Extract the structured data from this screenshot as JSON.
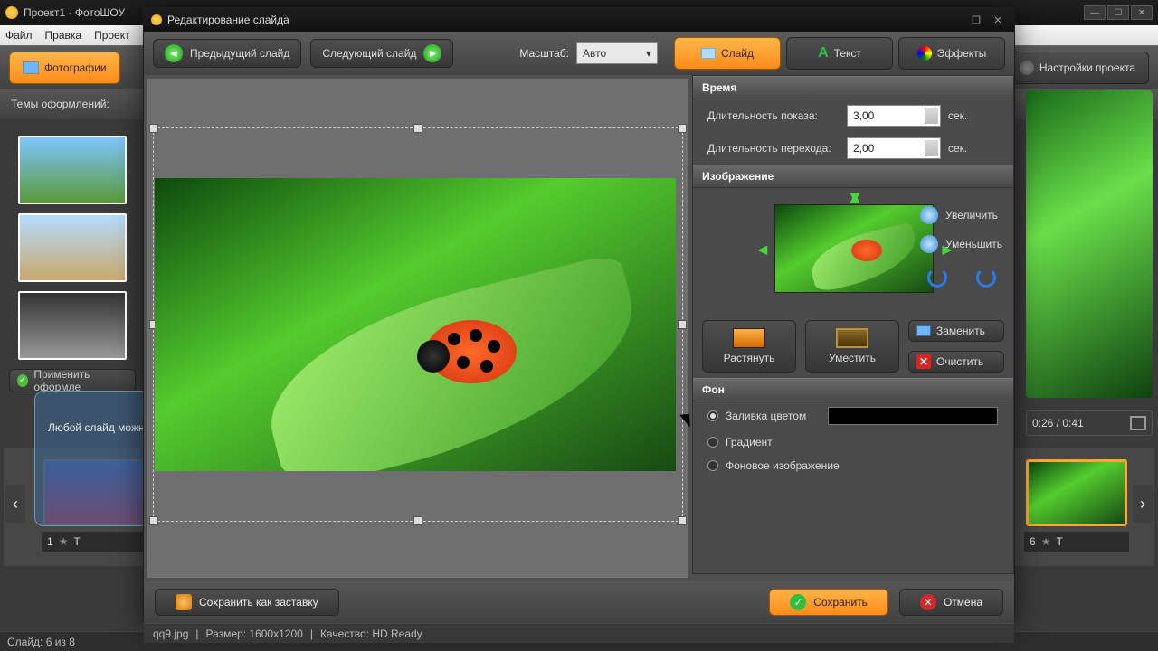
{
  "app_title": "Проект1 - ФотоШОУ",
  "menu": {
    "file": "Файл",
    "edit": "Правка",
    "project": "Проект"
  },
  "main_tabs": {
    "photos": "Фотографии"
  },
  "settings_btn": "Настройки проекта",
  "themes_label": "Темы оформлений:",
  "apply_theme": "Применить оформле",
  "overlay_text": "Любой слайд можно отредактировать",
  "timeline": {
    "slide1": "1",
    "slide6": "6"
  },
  "time_indicator": "0:26 / 0:41",
  "status_left": "Слайд: 6 из 8",
  "dialog": {
    "title": "Редактирование слайда",
    "prev": "Предыдущий слайд",
    "next": "Следующий слайд",
    "scale_label": "Масштаб:",
    "scale_value": "Авто",
    "tabs": {
      "slide": "Слайд",
      "text": "Текст",
      "effects": "Эффекты"
    },
    "time_header": "Время",
    "display_duration_label": "Длительность показа:",
    "display_duration_value": "3,00",
    "transition_duration_label": "Длительность перехода:",
    "transition_duration_value": "2,00",
    "sec": "сек.",
    "image_header": "Изображение",
    "zoom_in": "Увеличить",
    "zoom_out": "Уменьшить",
    "stretch": "Растянуть",
    "fit": "Уместить",
    "replace": "Заменить",
    "clear": "Очистить",
    "bg_header": "Фон",
    "bg_color": "Заливка цветом",
    "bg_gradient": "Градиент",
    "bg_image": "Фоновое изображение",
    "save_as_screensaver": "Сохранить как заставку",
    "save": "Сохранить",
    "cancel": "Отмена",
    "info_file": "qq9.jpg",
    "info_size": "Размер: 1600x1200",
    "info_quality": "Качество: HD Ready"
  }
}
